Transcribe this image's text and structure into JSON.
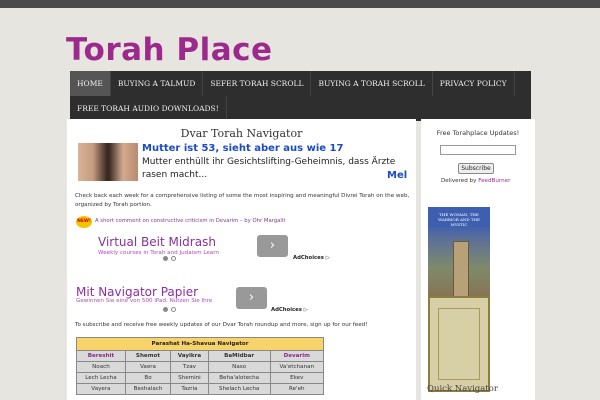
{
  "site": {
    "title": "Torah Place"
  },
  "nav": {
    "row1": [
      "HOME",
      "BUYING A TALMUD",
      "SEFER TORAH SCROLL",
      "BUYING A TORAH SCROLL",
      "PRIVACY POLICY"
    ],
    "row2": [
      "FREE TORAH AUDIO DOWNLOADS!"
    ],
    "active": "HOME"
  },
  "post": {
    "title": "Dvar Torah Navigator",
    "intro": "Check back each week for a comprehensive listing of some the most inspiring and meaningful Divrei Torah on the web, organized by Torah portion.",
    "new_badge": "NEW!",
    "new_link": "A short comment on constructive criticism in Devarim – by Ohr Margalit",
    "subscribe_note": "To subscribe and receive free weekly updates of our Dvar Torah roundup and more, sign up for our feed!"
  },
  "ads": {
    "ad1": {
      "headline": "Mutter ist 53, sieht aber aus wie 17",
      "body": "Mutter enthüllt ihr Gesichtslifting-Geheimnis, dass Ärzte rasen macht...",
      "more": "Mel"
    },
    "ad2": {
      "title": "Virtual Beit Midrash",
      "subtitle": "Weekly courses in Torah and Judaism Learn",
      "adchoices": "AdChoices ▷"
    },
    "ad3": {
      "title": "Mit Navigator Papier",
      "subtitle": "Gewinnen Sie eine von 500 iPad. Nutzen Sie Ihre",
      "adchoices": "AdChoices ▷"
    }
  },
  "table": {
    "header": "Parashat Ha-Shavua Navigator",
    "books": [
      "Bereshit",
      "Shemot",
      "Vayikra",
      "BaMidbar",
      "Devarim"
    ],
    "rows": [
      [
        "Noach",
        "Vaera",
        "Tzav",
        "Naso",
        "Va'etchanan"
      ],
      [
        "Lech Lecha",
        "Bo",
        "Shemini",
        "Beha'alotecha",
        "Ekev"
      ],
      [
        "Vayera",
        "Beshalach",
        "Tazria",
        "Shelach Lecha",
        "Re'eh"
      ]
    ]
  },
  "sidebar": {
    "updates_title": "Free Torahplace Updates!",
    "subscribe_label": "Subscribe",
    "delivered_by": "Delivered by",
    "feedburner": "FeedBurner",
    "book1_title": "THE WOMAN, THE WARRIOR AND THE MYSTIC",
    "quick_nav": "Quick Navigator"
  }
}
